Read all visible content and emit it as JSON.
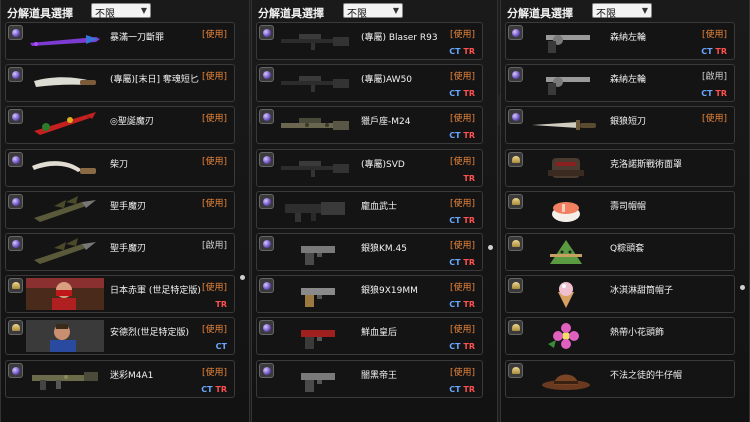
{
  "panels": [
    {
      "title": "分解道具選擇",
      "filter": {
        "label": "不限"
      },
      "rows": [
        {
          "badge": "weapon",
          "thumb": "dragon-sword",
          "name": "暴滿一刀斷罪",
          "status": "[使用]",
          "status_kind": "use",
          "ct": "",
          "tr": ""
        },
        {
          "badge": "weapon",
          "thumb": "knife-ivory",
          "name": "(專屬)[末日] 奪魂短匕",
          "status": "[使用]",
          "status_kind": "use",
          "ct": "",
          "tr": ""
        },
        {
          "badge": "weapon",
          "thumb": "red-claw",
          "name": "◎聖誕魔刃",
          "status": "[使用]",
          "status_kind": "use",
          "ct": "",
          "tr": ""
        },
        {
          "badge": "weapon",
          "thumb": "kukri",
          "name": "柴刀",
          "status": "[使用]",
          "status_kind": "use",
          "ct": "",
          "tr": ""
        },
        {
          "badge": "weapon",
          "thumb": "dragon-claw",
          "name": "聖手魔刃",
          "status": "[使用]",
          "status_kind": "use",
          "ct": "",
          "tr": ""
        },
        {
          "badge": "weapon",
          "thumb": "dragon-claw",
          "name": "聖手魔刃",
          "status": "[啟用]",
          "status_kind": "idle",
          "ct": "",
          "tr": ""
        },
        {
          "badge": "character",
          "thumb": "char-red",
          "name": "日本赤軍 (世足特定版)",
          "status": "[使用]",
          "status_kind": "use",
          "ct": "",
          "tr": "TR"
        },
        {
          "badge": "character",
          "thumb": "char-blue",
          "name": "安德烈(世足特定版)",
          "status": "[使用]",
          "status_kind": "use",
          "ct": "CT",
          "tr": ""
        },
        {
          "badge": "weapon",
          "thumb": "rifle-camo",
          "name": "迷彩M4A1",
          "status": "[使用]",
          "status_kind": "use",
          "ct": "CT",
          "tr": "TR"
        }
      ]
    },
    {
      "title": "分解道具選擇",
      "filter": {
        "label": "不限"
      },
      "rows": [
        {
          "badge": "weapon",
          "thumb": "sniper",
          "name": "(專屬) Blaser R93",
          "status": "[使用]",
          "status_kind": "use",
          "ct": "CT",
          "tr": "TR"
        },
        {
          "badge": "weapon",
          "thumb": "sniper",
          "name": "(專屬)AW50",
          "status": "[使用]",
          "status_kind": "use",
          "ct": "CT",
          "tr": "TR"
        },
        {
          "badge": "weapon",
          "thumb": "sniper-camo",
          "name": "獵戶座-M24",
          "status": "[使用]",
          "status_kind": "use",
          "ct": "CT",
          "tr": "TR"
        },
        {
          "badge": "weapon",
          "thumb": "sniper",
          "name": "(專屬)SVD",
          "status": "[使用]",
          "status_kind": "use",
          "ct": "",
          "tr": "TR"
        },
        {
          "badge": "weapon",
          "thumb": "grenade-launcher",
          "name": "龐血武士",
          "status": "[使用]",
          "status_kind": "use",
          "ct": "CT",
          "tr": "TR"
        },
        {
          "badge": "weapon",
          "thumb": "pistol",
          "name": "銀狼KM.45",
          "status": "[使用]",
          "status_kind": "use",
          "ct": "CT",
          "tr": "TR"
        },
        {
          "badge": "weapon",
          "thumb": "pistol-gold",
          "name": "銀狼9X19MM",
          "status": "[使用]",
          "status_kind": "use",
          "ct": "CT",
          "tr": "TR"
        },
        {
          "badge": "weapon",
          "thumb": "pistol-red",
          "name": "鮮血皇后",
          "status": "[使用]",
          "status_kind": "use",
          "ct": "CT",
          "tr": "TR"
        },
        {
          "badge": "weapon",
          "thumb": "pistol",
          "name": "闇黑帝王",
          "status": "[使用]",
          "status_kind": "use",
          "ct": "CT",
          "tr": "TR"
        }
      ]
    },
    {
      "title": "分解道具選擇",
      "filter": {
        "label": "不限"
      },
      "rows": [
        {
          "badge": "weapon",
          "thumb": "revolver",
          "name": "森納左輪",
          "status": "[使用]",
          "status_kind": "use",
          "ct": "CT",
          "tr": "TR"
        },
        {
          "badge": "weapon",
          "thumb": "revolver",
          "name": "森納左輪",
          "status": "[啟用]",
          "status_kind": "idle",
          "ct": "CT",
          "tr": "TR"
        },
        {
          "badge": "weapon",
          "thumb": "dagger",
          "name": "銀狼短刀",
          "status": "[使用]",
          "status_kind": "use",
          "ct": "",
          "tr": ""
        },
        {
          "badge": "headgear",
          "thumb": "mask",
          "name": "克洛諾斯戰術面罩",
          "status": "",
          "status_kind": "",
          "ct": "",
          "tr": ""
        },
        {
          "badge": "headgear",
          "thumb": "sushi",
          "name": "壽司帽帽",
          "status": "",
          "status_kind": "",
          "ct": "",
          "tr": ""
        },
        {
          "badge": "headgear",
          "thumb": "zongzi",
          "name": "Q粽頭套",
          "status": "",
          "status_kind": "",
          "ct": "",
          "tr": ""
        },
        {
          "badge": "headgear",
          "thumb": "icecream",
          "name": "冰淇淋甜筒帽子",
          "status": "",
          "status_kind": "",
          "ct": "",
          "tr": ""
        },
        {
          "badge": "headgear",
          "thumb": "flower",
          "name": "熱帶小花頭飾",
          "status": "",
          "status_kind": "",
          "ct": "",
          "tr": ""
        },
        {
          "badge": "headgear",
          "thumb": "cowboy-hat",
          "name": "不法之徒的牛仔帽",
          "status": "",
          "status_kind": "",
          "ct": "",
          "tr": ""
        }
      ]
    }
  ],
  "colors": {
    "use": "#e8863a",
    "idle": "#d0d0d0",
    "ct": "#6aa8ff",
    "tr": "#ff5050"
  }
}
